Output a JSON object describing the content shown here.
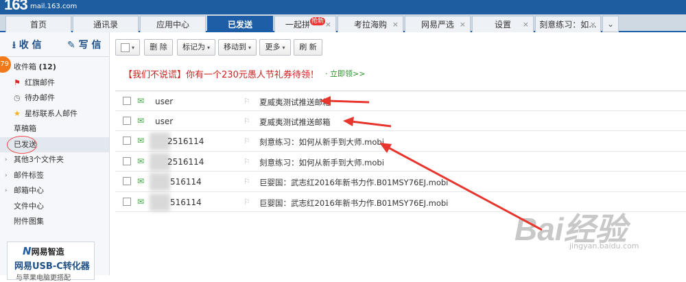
{
  "topbar": {
    "logo": "163",
    "logo_sub": "mail.163.com"
  },
  "tabs": [
    {
      "label": "首页"
    },
    {
      "label": "通讯录"
    },
    {
      "label": "应用中心"
    },
    {
      "label": "已发送"
    },
    {
      "label": "一起拼",
      "badge": "抢新"
    },
    {
      "label": "考拉海购"
    },
    {
      "label": "网易严选"
    },
    {
      "label": "设置"
    },
    {
      "label": "刻意练习：如..."
    }
  ],
  "sidebar": {
    "receive": "收 信",
    "compose": "写 信",
    "unread_count": "79",
    "items": [
      {
        "label": "收件箱",
        "count": "(12)"
      },
      {
        "label": "红旗邮件"
      },
      {
        "label": "待办邮件"
      },
      {
        "label": "星标联系人邮件"
      },
      {
        "label": "草稿箱"
      },
      {
        "label": "已发送"
      },
      {
        "label": "其他3个文件夹"
      },
      {
        "label": "邮件标签"
      },
      {
        "label": "邮箱中心"
      },
      {
        "label": "文件中心"
      },
      {
        "label": "附件图集"
      }
    ],
    "ad": {
      "brand": "网易智造",
      "title": "网易USB-C转化器",
      "sub": "与苹果电脑更搭配"
    }
  },
  "toolbar": {
    "delete": "删 除",
    "mark_as": "标记为",
    "move_to": "移动到",
    "more": "更多",
    "refresh": "刷 新"
  },
  "promo": {
    "text": "【我们不说谎】你有一个230元愚人节礼券待领！",
    "link": "立即领>>"
  },
  "mails": [
    {
      "from": "user",
      "subject": "夏威夷测试推送邮箱"
    },
    {
      "from": "user",
      "subject": "夏威夷测试推送邮箱"
    },
    {
      "from": "2516114",
      "subject": "刻意练习：如何从新手到大师.mobi"
    },
    {
      "from": "2516114",
      "subject": "刻意练习：如何从新手到大师.mobi"
    },
    {
      "from": "516114",
      "subject": "巨婴国：武志红2016年新书力作.B01MSY76EJ.mobi"
    },
    {
      "from": "516114",
      "subject": "巨婴国：武志红2016年新书力作.B01MSY76EJ.mobi"
    }
  ],
  "watermark": {
    "main": "Bai经验",
    "sub": "jingyan.baidu.com"
  },
  "colors": {
    "brand_blue": "#1d5ea6",
    "promo_red": "#d01c1c",
    "arrow_red": "#e8352d"
  }
}
